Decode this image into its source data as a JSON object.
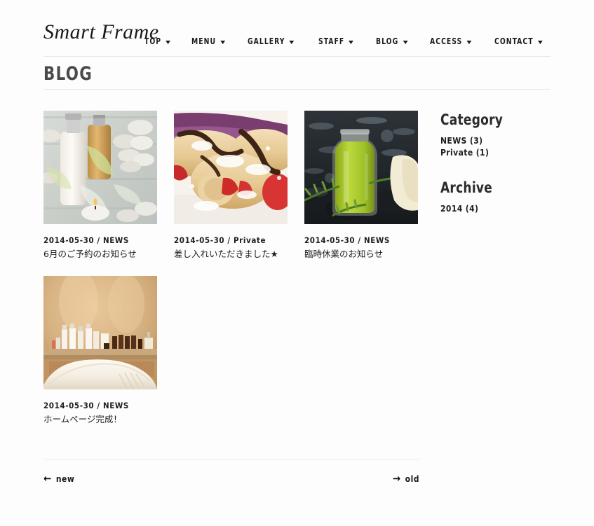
{
  "site": {
    "logo": "Smart Frame"
  },
  "nav": {
    "items": [
      {
        "label": "TOP",
        "icon": "chevron-down-icon"
      },
      {
        "label": "MENU",
        "icon": "chevron-down-icon"
      },
      {
        "label": "GALLERY",
        "icon": "chevron-down-icon"
      },
      {
        "label": "STAFF",
        "icon": "chevron-down-icon"
      },
      {
        "label": "BLOG",
        "icon": "chevron-down-icon"
      },
      {
        "label": "ACCESS",
        "icon": "chevron-down-icon"
      },
      {
        "label": "CONTACT",
        "icon": "chevron-down-icon"
      }
    ]
  },
  "page": {
    "title": "BLOG"
  },
  "posts": [
    {
      "meta": "2014-05-30 / NEWS",
      "title": "6月のご予約のお知らせ",
      "image_alt": "spa-bottles-stones-candle-thumbnail"
    },
    {
      "meta": "2014-05-30 / Private",
      "title": "差し入れいただきました★",
      "image_alt": "crepes-strawberries-chocolate-thumbnail"
    },
    {
      "meta": "2014-05-30 / NEWS",
      "title": "臨時休業のお知らせ",
      "image_alt": "green-oil-bottle-rosemary-thumbnail"
    },
    {
      "meta": "2014-05-30 / NEWS",
      "title": "ホームページ完成！",
      "image_alt": "spa-treatment-room-thumbnail"
    }
  ],
  "sidebar": {
    "category": {
      "heading": "Category",
      "items": [
        {
          "label": "NEWS (3)"
        },
        {
          "label": "Private (1)"
        }
      ]
    },
    "archive": {
      "heading": "Archive",
      "items": [
        {
          "label": "2014 (4)"
        }
      ]
    }
  },
  "pagination": {
    "newer": {
      "label": "new",
      "arrow": "←"
    },
    "older": {
      "label": "old",
      "arrow": "→"
    }
  },
  "colors": {
    "background": "#fdfdfd",
    "text": "#1e1e1e",
    "title": "#4a4a4a",
    "rule": "#e8e8e8"
  }
}
